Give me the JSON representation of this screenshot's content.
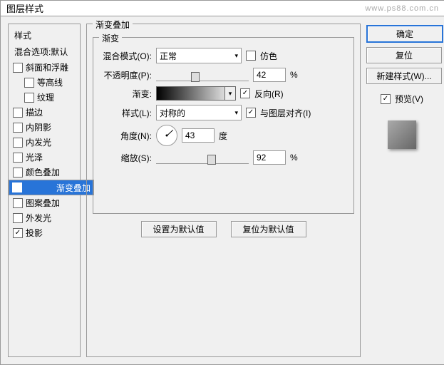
{
  "title": "图层样式",
  "watermark": "www.ps88.com.cn",
  "sidebar": {
    "header": "样式",
    "blending": "混合选项:默认",
    "items": [
      {
        "label": "斜面和浮雕",
        "checked": false,
        "indent": false
      },
      {
        "label": "等高线",
        "checked": false,
        "indent": true
      },
      {
        "label": "纹理",
        "checked": false,
        "indent": true
      },
      {
        "label": "描边",
        "checked": false,
        "indent": false
      },
      {
        "label": "内阴影",
        "checked": false,
        "indent": false
      },
      {
        "label": "内发光",
        "checked": false,
        "indent": false
      },
      {
        "label": "光泽",
        "checked": false,
        "indent": false
      },
      {
        "label": "颜色叠加",
        "checked": false,
        "indent": false
      },
      {
        "label": "渐变叠加",
        "checked": true,
        "indent": false,
        "selected": true
      },
      {
        "label": "图案叠加",
        "checked": false,
        "indent": false
      },
      {
        "label": "外发光",
        "checked": false,
        "indent": false
      },
      {
        "label": "投影",
        "checked": true,
        "indent": false
      }
    ]
  },
  "main": {
    "group": "渐变叠加",
    "subgroup": "渐变",
    "blend": {
      "label": "混合模式(O):",
      "value": "正常",
      "dither": "仿色"
    },
    "opacity": {
      "label": "不透明度(P):",
      "value": "42",
      "unit": "%",
      "pos": 42
    },
    "gradient": {
      "label": "渐变:",
      "reverse": "反向(R)"
    },
    "style": {
      "label": "样式(L):",
      "value": "对称的",
      "align": "与图层对齐(I)"
    },
    "angle": {
      "label": "角度(N):",
      "value": "43",
      "unit": "度"
    },
    "scale": {
      "label": "缩放(S):",
      "value": "92",
      "unit": "%",
      "pos": 60
    },
    "btn_default": "设置为默认值",
    "btn_reset": "复位为默认值"
  },
  "right": {
    "ok": "确定",
    "cancel": "复位",
    "newstyle": "新建样式(W)...",
    "preview": "预览(V)"
  }
}
